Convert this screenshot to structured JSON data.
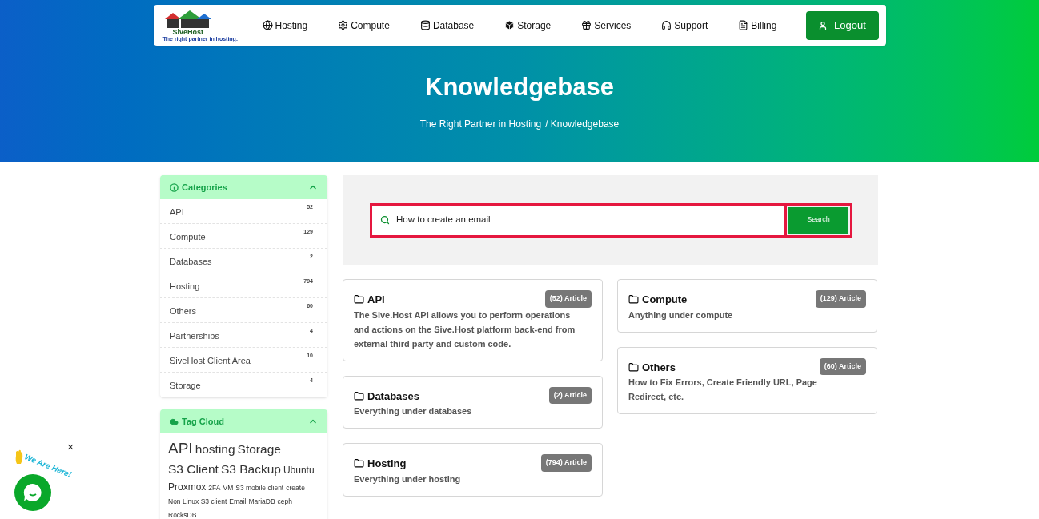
{
  "nav": {
    "logo_name": "SiveHost",
    "logo_tagline": "The right partner in hosting.",
    "items": [
      {
        "label": "Hosting",
        "kind": "globe"
      },
      {
        "label": "Compute",
        "kind": "gear"
      },
      {
        "label": "Database",
        "kind": "database"
      },
      {
        "label": "Storage",
        "kind": "box"
      },
      {
        "label": "Services",
        "kind": "gift"
      },
      {
        "label": "Support",
        "kind": "headset"
      },
      {
        "label": "Billing",
        "kind": "invoice"
      }
    ],
    "logout": "Logout"
  },
  "hero": {
    "title": "Knowledgebase",
    "breadcrumb": [
      "The Right Partner in Hosting",
      "/ Knowledgebase"
    ]
  },
  "categories": {
    "title": "Categories",
    "expanded": true,
    "items": [
      {
        "name": "API",
        "count": "52"
      },
      {
        "name": "Compute",
        "count": "129"
      },
      {
        "name": "Databases",
        "count": "2"
      },
      {
        "name": "Hosting",
        "count": "794"
      },
      {
        "name": "Others",
        "count": "60"
      },
      {
        "name": "Partnerships",
        "count": "4"
      },
      {
        "name": "SiveHost Client Area",
        "count": "10"
      },
      {
        "name": "Storage",
        "count": "4"
      }
    ]
  },
  "tag_cloud": {
    "title": "Tag Cloud",
    "expanded": true,
    "tags": [
      {
        "label": "API",
        "kind": "large"
      },
      {
        "label": "hosting",
        "kind": "medium"
      },
      {
        "label": "Storage",
        "kind": "medium"
      },
      {
        "label": "S3 Client",
        "kind": "medium"
      },
      {
        "label": "S3 Backup",
        "kind": "medium"
      },
      {
        "label": "Ubuntu",
        "kind": "small"
      },
      {
        "label": "Proxmox",
        "kind": "small"
      },
      {
        "label": "2FA",
        "kind": "tiny"
      },
      {
        "label": "VM",
        "kind": "tiny"
      },
      {
        "label": "S3 mobile client",
        "kind": "tiny"
      },
      {
        "label": "create",
        "kind": "tiny"
      },
      {
        "label": "Non Linux S3 client",
        "kind": "tiny"
      },
      {
        "label": "Email",
        "kind": "tiny"
      },
      {
        "label": "MariaDB",
        "kind": "tiny"
      },
      {
        "label": "ceph",
        "kind": "tiny"
      },
      {
        "label": "RocksDB",
        "kind": "tiny"
      }
    ]
  },
  "search": {
    "value": "How to create an email",
    "button": "Search"
  },
  "card_columns": [
    {
      "cards": [
        {
          "title": "API",
          "badge": "(52) Article",
          "description": "The Sive.Host API allows you to perform operations and actions on the Sive.Host platform back-end from external third party and custom code."
        },
        {
          "title": "Databases",
          "badge": "(2) Article",
          "description": "Everything under databases"
        },
        {
          "title": "Hosting",
          "badge": "(794) Article",
          "description": "Everything under hosting"
        }
      ]
    },
    {
      "cards": [
        {
          "title": "Compute",
          "badge": "(129) Article",
          "description": "Anything under compute"
        },
        {
          "title": "Others",
          "badge": "(60) Article",
          "description": "How to Fix Errors, Create Friendly URL, Page Redirect, etc."
        }
      ]
    }
  ],
  "chat_widget": {
    "label": "We Are Here!",
    "close": "×"
  }
}
